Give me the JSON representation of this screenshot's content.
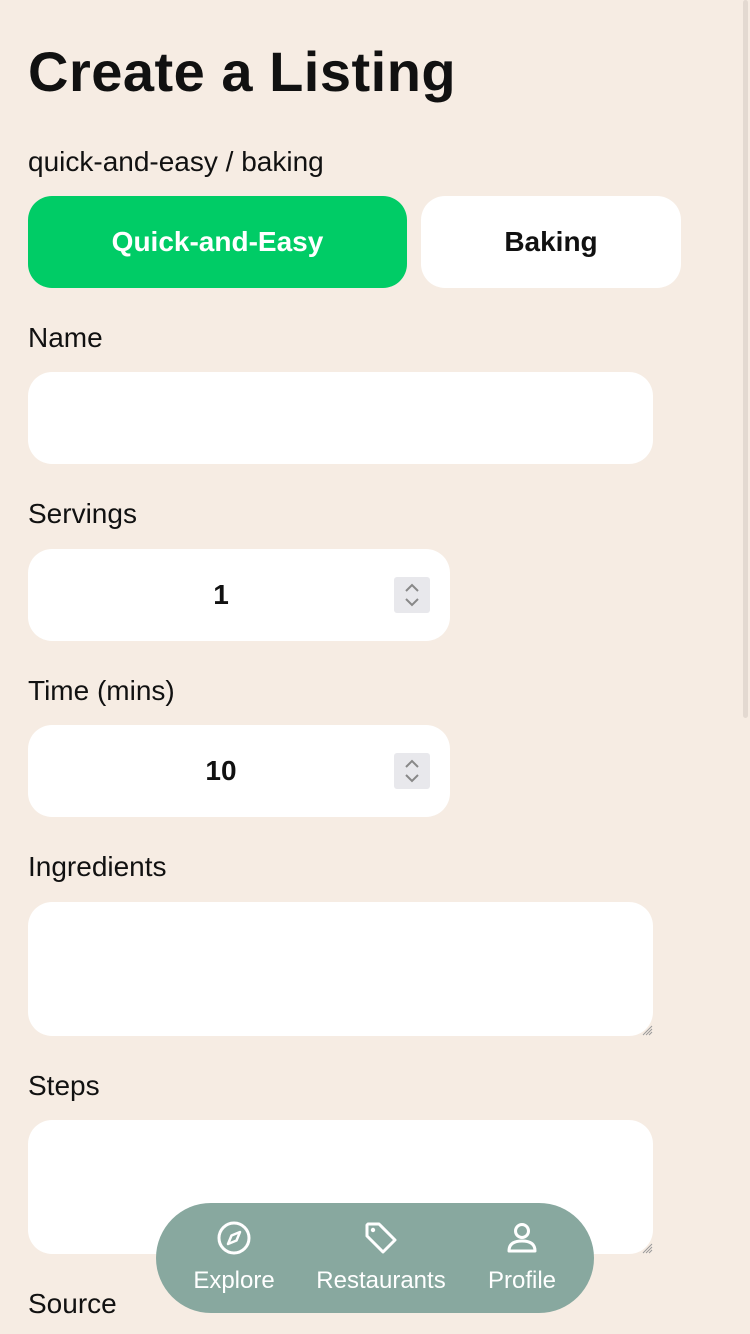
{
  "page": {
    "title": "Create a Listing",
    "path": "quick-and-easy / baking"
  },
  "categories": {
    "items": [
      {
        "label": "Quick-and-Easy",
        "selected": true
      },
      {
        "label": "Baking",
        "selected": false
      }
    ],
    "selected_color": "#00cc66"
  },
  "form": {
    "name": {
      "label": "Name",
      "value": ""
    },
    "servings": {
      "label": "Servings",
      "value": "1"
    },
    "time": {
      "label": "Time (mins)",
      "value": "10"
    },
    "ingredients": {
      "label": "Ingredients",
      "value": ""
    },
    "steps": {
      "label": "Steps",
      "value": ""
    },
    "source": {
      "label": "Source"
    }
  },
  "nav": {
    "background": "#88a89f",
    "items": [
      {
        "label": "Explore",
        "icon": "compass-icon"
      },
      {
        "label": "Restaurants",
        "icon": "tag-icon"
      },
      {
        "label": "Profile",
        "icon": "user-icon"
      }
    ]
  },
  "colors": {
    "background": "#f6ece3",
    "field": "#ffffff"
  }
}
